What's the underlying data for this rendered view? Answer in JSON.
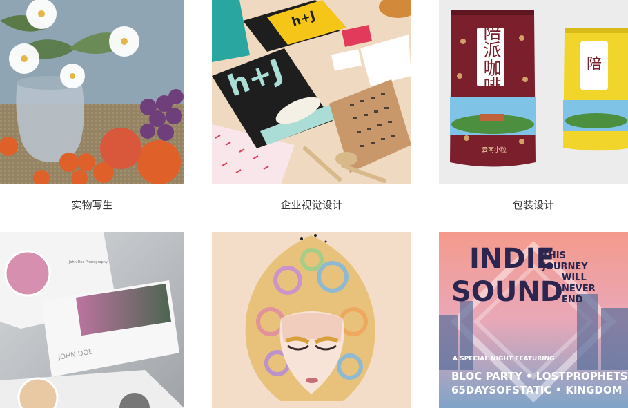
{
  "gallery": {
    "items": [
      {
        "caption": "实物写生",
        "image": "still-life-painting"
      },
      {
        "caption": "企业视觉设计",
        "image": "corporate-identity-stationery"
      },
      {
        "caption": "包装设计",
        "image": "coffee-bag-packaging"
      },
      {
        "caption": "",
        "image": "photo-brochure-mockup"
      },
      {
        "caption": "",
        "image": "girl-face-illustration"
      },
      {
        "caption": "",
        "image": "indie-sound-poster"
      }
    ]
  },
  "brochure": {
    "name": "JOHN DOE",
    "subtitle": "John Doe Photography"
  },
  "packaging": {
    "brand_cn": "陪派咖啡",
    "small_text": "云南小粒"
  },
  "stationery": {
    "logo": "h+J"
  },
  "poster": {
    "line1": "INDIE",
    "line2": "SOUND",
    "tag_lines": [
      "THIS",
      "JOURNEY",
      "WILL",
      "NEVER",
      "END"
    ],
    "featuring": "A SPECIAL NIGHT FEATURING",
    "bands1": "BLOC PARTY • LOSTPROPHETS",
    "bands2": "65DAYSOFSTATIC • KINGDOM"
  },
  "colors": {
    "caption_text": "#333333",
    "poster_pink": "#f07b8a",
    "stationery_yellow": "#f5c518",
    "bag_maroon": "#7a1f2b"
  }
}
